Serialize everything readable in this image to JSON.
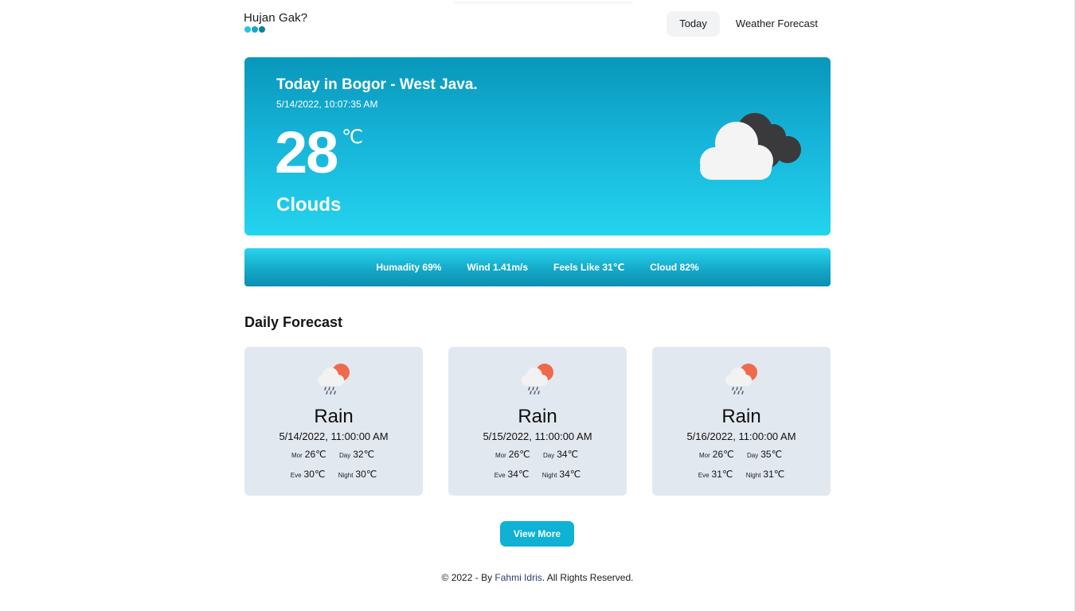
{
  "colors": {
    "accent": "#0fb1d4",
    "dot1": "#22c4e4",
    "dot2": "#10a7c9",
    "dot3": "#0b7f9e",
    "card_bg": "#e2e8f0"
  },
  "brand": {
    "name": "Hujan Gak?"
  },
  "nav": {
    "today": "Today",
    "forecast": "Weather Forecast"
  },
  "current": {
    "title": "Today in Bogor - West Java.",
    "datetime": "5/14/2022, 10:07:35 AM",
    "temp": "28",
    "unit": "℃",
    "condition": "Clouds",
    "icon": "clouds-icon"
  },
  "stats": {
    "humidity": "Humadity 69%",
    "wind": "Wind 1.41m/s",
    "feels_like": "Feels Like 31℃",
    "cloud": "Cloud 82%"
  },
  "daily": {
    "title": "Daily Forecast",
    "cards": [
      {
        "condition": "Rain",
        "date": "5/14/2022, 11:00:00 AM",
        "icon": "rain-sun-icon",
        "mor_label": "Mor",
        "mor": "26℃",
        "day_label": "Day",
        "day": "32℃",
        "eve_label": "Eve",
        "eve": "30℃",
        "night_label": "Night",
        "night": "30℃"
      },
      {
        "condition": "Rain",
        "date": "5/15/2022, 11:00:00 AM",
        "icon": "rain-sun-icon",
        "mor_label": "Mor",
        "mor": "26℃",
        "day_label": "Day",
        "day": "34℃",
        "eve_label": "Eve",
        "eve": "34℃",
        "night_label": "Night",
        "night": "34℃"
      },
      {
        "condition": "Rain",
        "date": "5/16/2022, 11:00:00 AM",
        "icon": "rain-sun-icon",
        "mor_label": "Mor",
        "mor": "26℃",
        "day_label": "Day",
        "day": "35℃",
        "eve_label": "Eve",
        "eve": "31℃",
        "night_label": "Night",
        "night": "31℃"
      }
    ]
  },
  "view_more": "View More",
  "footer": {
    "prefix": "© 2022 - By ",
    "author": "Fahmi Idris",
    "suffix": ". All Rights Reserved."
  }
}
